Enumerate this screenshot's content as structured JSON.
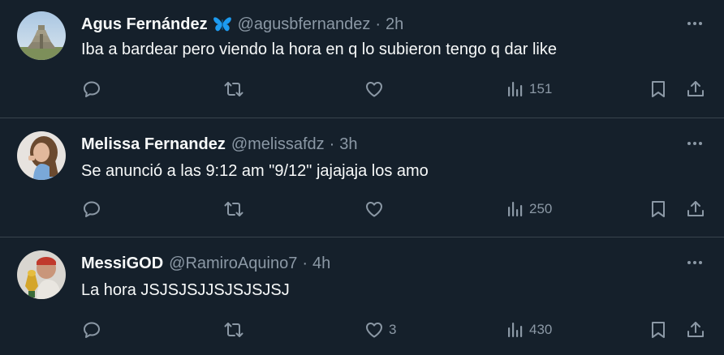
{
  "tweets": [
    {
      "name": "Agus Fernández",
      "badge": "butterfly-emoji",
      "handle": "@agusbfernandez",
      "time": "2h",
      "text": "Iba a bardear pero viendo la hora en q lo subieron tengo q dar like",
      "likes": "",
      "views": "151"
    },
    {
      "name": "Melissa Fernandez",
      "handle": "@melissafdz",
      "time": "3h",
      "text": "Se anunció a las 9:12 am \"9/12\" jajajaja los amo",
      "likes": "",
      "views": "250"
    },
    {
      "name": "MessiGOD",
      "handle": "@RamiroAquino7",
      "time": "4h",
      "text": "La hora JSJSJSJJSJSJSJSJ",
      "likes": "3",
      "views": "430"
    }
  ],
  "dot_separator": "·",
  "colors": {
    "background": "#15202b",
    "divider": "#38444d",
    "primary_text": "#f7f9f9",
    "secondary_text": "#8b98a5",
    "badge_blue": "#1d9bf0"
  },
  "icons": [
    "reply-icon",
    "retweet-icon",
    "like-icon",
    "views-icon",
    "bookmark-icon",
    "share-icon",
    "more-icon"
  ]
}
